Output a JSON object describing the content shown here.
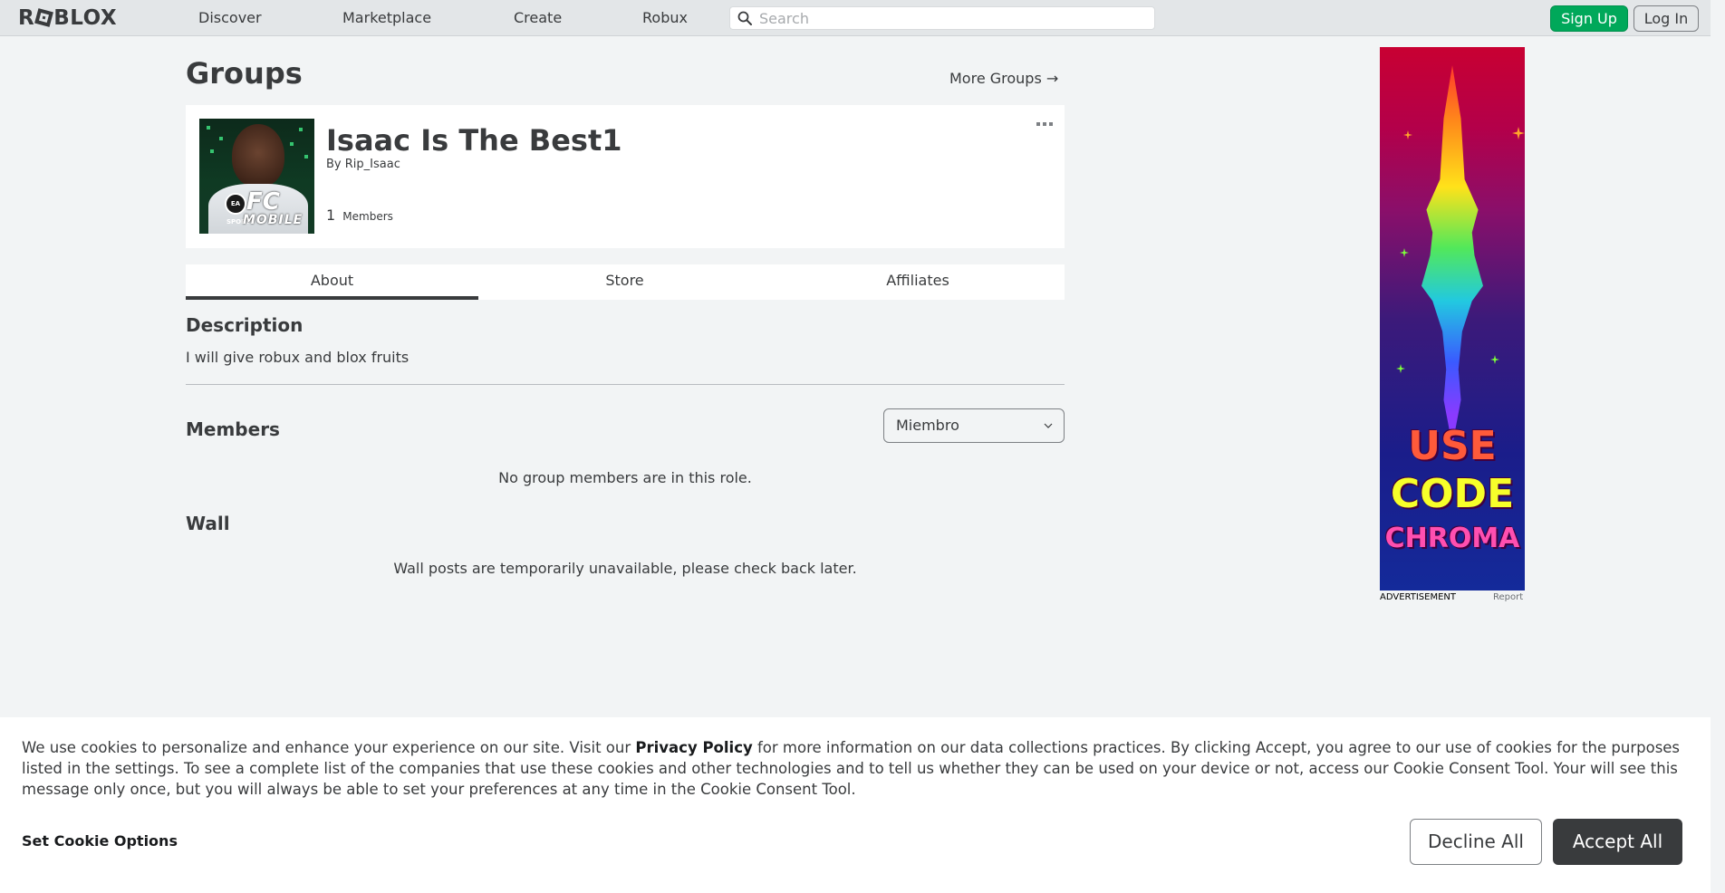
{
  "topnav": {
    "logo_text": "ROBLOX",
    "links": [
      "Discover",
      "Marketplace",
      "Create",
      "Robux"
    ],
    "search_placeholder": "Search",
    "signup_label": "Sign Up",
    "login_label": "Log In"
  },
  "page": {
    "title": "Groups",
    "more_groups_label": "More Groups",
    "more_groups_arrow": "→"
  },
  "group": {
    "name": "Isaac Is The Best1",
    "by_label": "By",
    "owner": "Rip_Isaac",
    "member_count": "1",
    "member_label": "Members",
    "emblem_text_big": "FC",
    "emblem_text_small": "MOBILE",
    "emblem_badge": "EA SPORTS"
  },
  "tabs": [
    "About",
    "Store",
    "Affiliates"
  ],
  "about": {
    "description_heading": "Description",
    "description_text": "I will give robux and blox fruits",
    "members_heading": "Members",
    "role_selected": "Miembro",
    "members_empty": "No group members are in this role.",
    "wall_heading": "Wall",
    "wall_empty": "Wall posts are temporarily unavailable, please check back later."
  },
  "ad": {
    "line1": "USE",
    "line2": "CODE",
    "line3": "CHROMA",
    "label": "ADVERTISEMENT",
    "report": "Report"
  },
  "cookie": {
    "text_before": "We use cookies to personalize and enhance your experience on our site. Visit our ",
    "privacy_link": "Privacy Policy",
    "text_after": " for more information on our data collections practices. By clicking Accept, you agree to our use of cookies for the purposes listed in the settings. To see a complete list of the companies that use these cookies and other technologies and to tell us whether they can be used on your device or not, access our Cookie Consent Tool. Your will see this message only once, but you will always be able to set your preferences at any time in the Cookie Consent Tool.",
    "set_options": "Set Cookie Options",
    "decline": "Decline All",
    "accept": "Accept All"
  },
  "colors": {
    "page_bg": "#f2f4f5",
    "nav_bg": "#e3e6e8",
    "signup_green": "#00a85a",
    "text_dark": "#393b3d",
    "accept_bg": "#393b3d"
  }
}
